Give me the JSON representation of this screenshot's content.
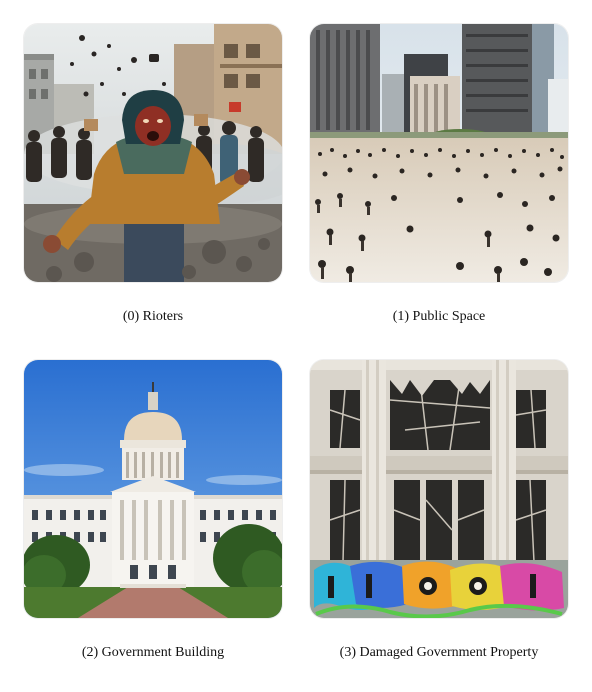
{
  "panels": [
    {
      "index": "(0)",
      "label": "Rioters",
      "caption": "(0) Rioters"
    },
    {
      "index": "(1)",
      "label": "Public Space",
      "caption": "(1) Public Space"
    },
    {
      "index": "(2)",
      "label": "Government Building",
      "caption": "(2) Government Building"
    },
    {
      "index": "(3)",
      "label": "Damaged Government Property",
      "caption": "(3) Damaged Government Property"
    }
  ]
}
